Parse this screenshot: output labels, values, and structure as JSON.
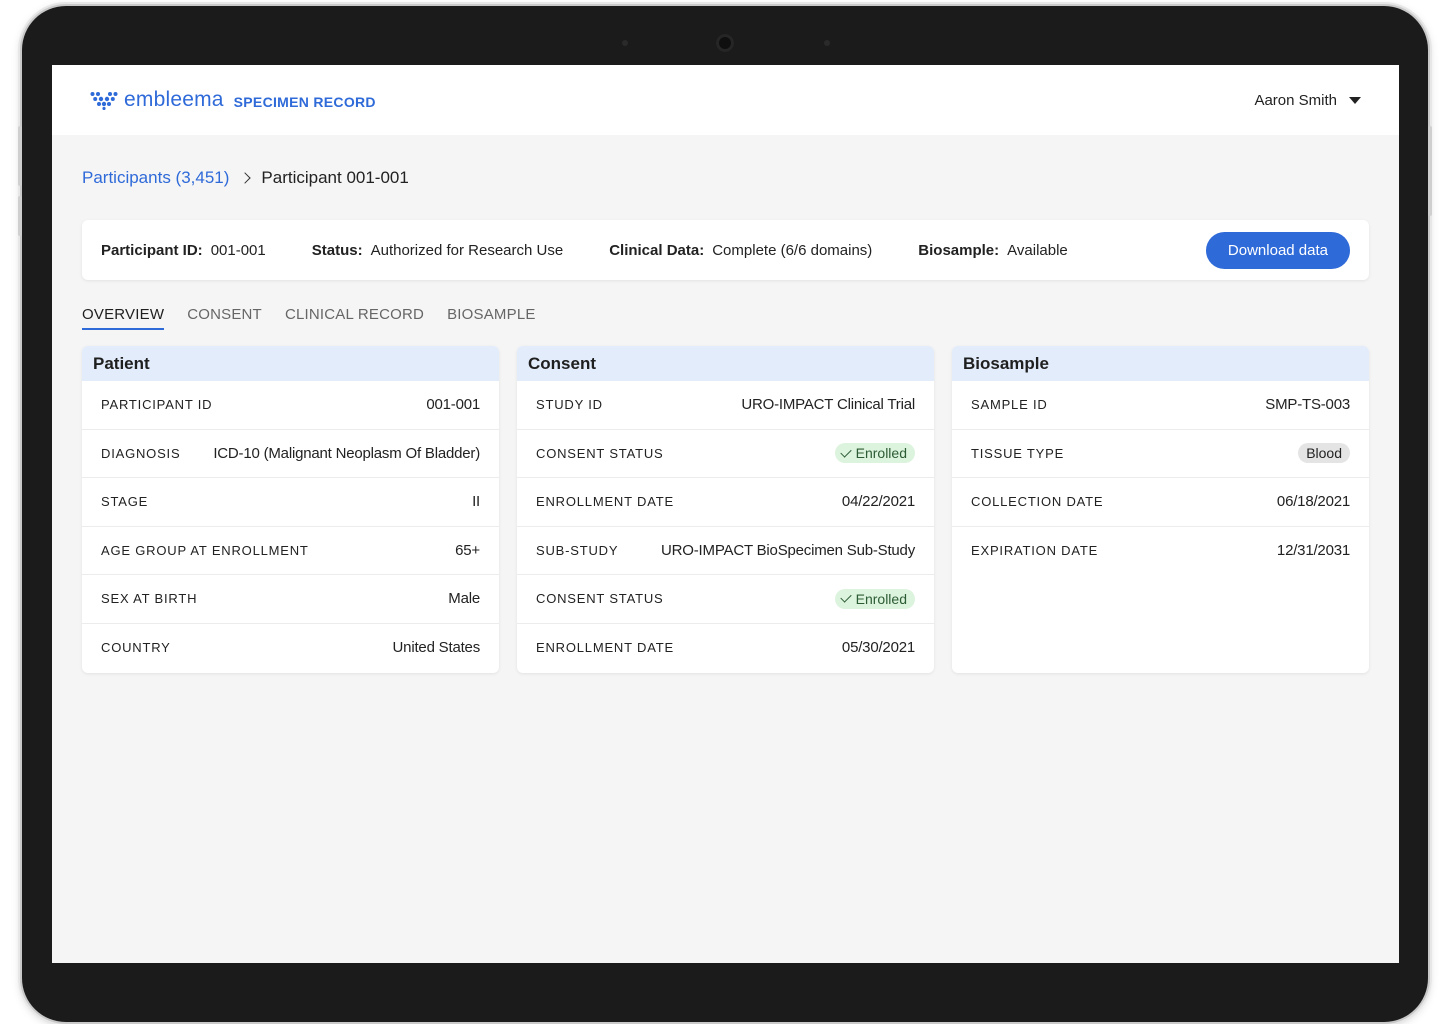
{
  "header": {
    "brand_name": "embleema",
    "brand_subtitle": "SPECIMEN RECORD",
    "user_name": "Aaron Smith",
    "brand_color": "#2f6ad9"
  },
  "breadcrumb": {
    "parent": "Participants (3,451)",
    "current": "Participant 001-001"
  },
  "summary": {
    "items": [
      {
        "label": "Participant ID:",
        "value": "001-001"
      },
      {
        "label": "Status:",
        "value": "Authorized for Research Use"
      },
      {
        "label": "Clinical Data:",
        "value": "Complete (6/6 domains)"
      },
      {
        "label": "Biosample:",
        "value": "Available"
      }
    ],
    "download_label": "Download data"
  },
  "tabs": [
    "OVERVIEW",
    "CONSENT",
    "CLINICAL RECORD",
    "BIOSAMPLE"
  ],
  "patient": {
    "title": "Patient",
    "rows": [
      {
        "key": "PARTICIPANT ID",
        "value": "001-001"
      },
      {
        "key": "DIAGNOSIS",
        "value": "ICD-10 (Malignant Neoplasm Of Bladder)"
      },
      {
        "key": "STAGE",
        "value": "II"
      },
      {
        "key": "AGE GROUP AT ENROLLMENT",
        "value": "65+"
      },
      {
        "key": "SEX AT BIRTH",
        "value": "Male"
      },
      {
        "key": "COUNTRY",
        "value": "United States"
      }
    ]
  },
  "consent": {
    "title": "Consent",
    "rows": [
      {
        "key": "STUDY ID",
        "value": "URO-IMPACT Clinical Trial"
      },
      {
        "key": "CONSENT STATUS",
        "value": "Enrolled"
      },
      {
        "key": "ENROLLMENT DATE",
        "value": "04/22/2021"
      },
      {
        "key": "SUB-STUDY",
        "value": "URO-IMPACT BioSpecimen Sub-Study"
      },
      {
        "key": "CONSENT STATUS",
        "value": "Enrolled"
      },
      {
        "key": "ENROLLMENT DATE",
        "value": "05/30/2021"
      }
    ]
  },
  "biosample": {
    "title": "Biosample",
    "rows": [
      {
        "key": "SAMPLE ID",
        "value": "SMP-TS-003"
      },
      {
        "key": "TISSUE TYPE",
        "value": "Blood"
      },
      {
        "key": "COLLECTION DATE",
        "value": "06/18/2021"
      },
      {
        "key": "EXPIRATION DATE",
        "value": "12/31/2031"
      }
    ]
  },
  "icons": {
    "logo": "embleema-logo-icon",
    "user_menu": "caret-down-icon",
    "breadcrumb_separator": "chevron-right-icon",
    "status_check": "check-icon"
  }
}
